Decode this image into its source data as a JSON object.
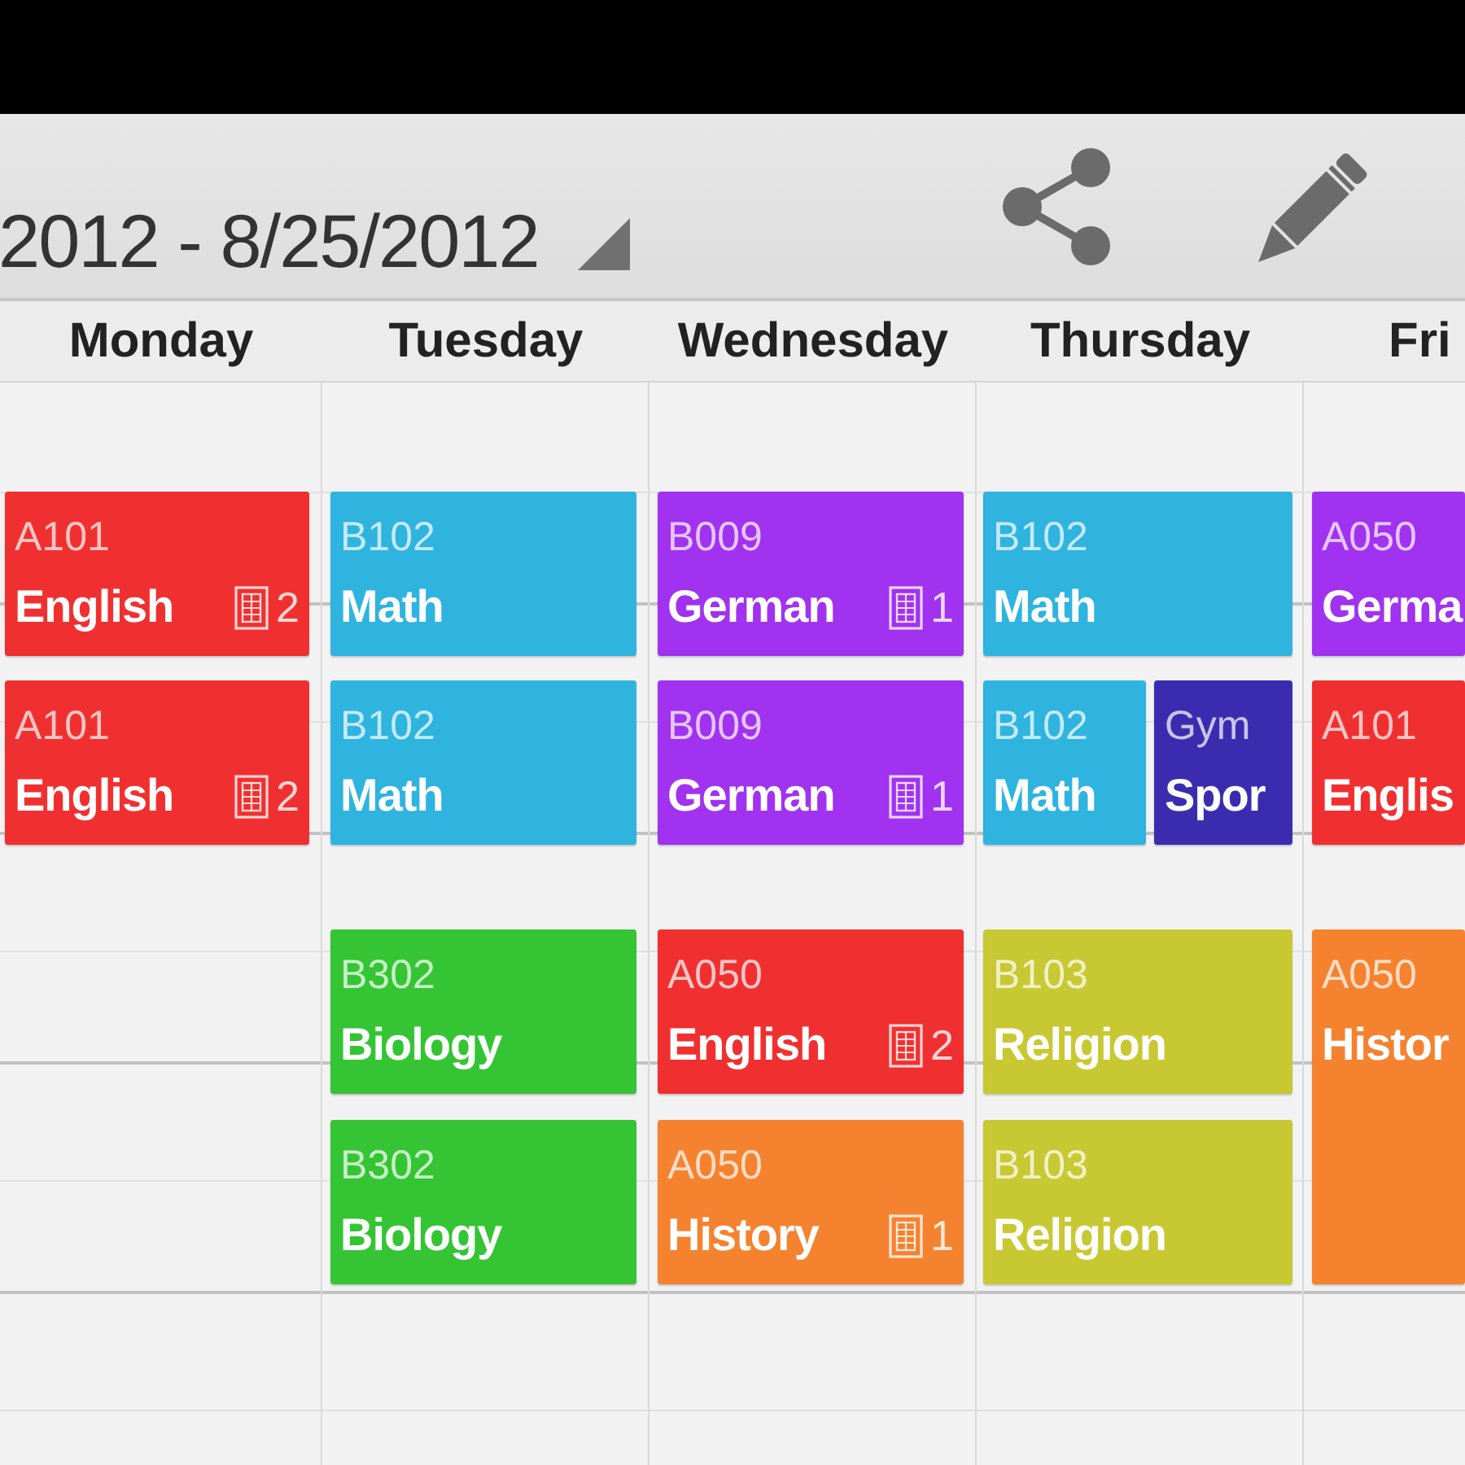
{
  "action_bar": {
    "date_range": "2012 - 8/25/2012"
  },
  "days": [
    {
      "name": "Monday",
      "periods": [
        {
          "kind": "single",
          "room": "A101",
          "subject": "English",
          "homework": "2",
          "color": "#f03030"
        },
        {
          "kind": "single",
          "room": "A101",
          "subject": "English",
          "homework": "2",
          "color": "#f03030"
        }
      ]
    },
    {
      "name": "Tuesday",
      "periods": [
        {
          "kind": "single",
          "room": "B102",
          "subject": "Math",
          "color": "#2eb4de"
        },
        {
          "kind": "single",
          "room": "B102",
          "subject": "Math",
          "color": "#2eb4de"
        },
        {
          "kind": "single",
          "room": "B302",
          "subject": "Biology",
          "color": "#34c434"
        },
        {
          "kind": "single",
          "room": "B302",
          "subject": "Biology",
          "color": "#34c434"
        }
      ]
    },
    {
      "name": "Wednesday",
      "periods": [
        {
          "kind": "single",
          "room": "B009",
          "subject": "German",
          "homework": "1",
          "color": "#a032f0"
        },
        {
          "kind": "single",
          "room": "B009",
          "subject": "German",
          "homework": "1",
          "color": "#a032f0"
        },
        {
          "kind": "single",
          "room": "A050",
          "subject": "English",
          "homework": "2",
          "color": "#f03030"
        },
        {
          "kind": "single",
          "room": "A050",
          "subject": "History",
          "homework": "1",
          "color": "#f5822f"
        }
      ]
    },
    {
      "name": "Thursday",
      "periods": [
        {
          "kind": "single",
          "room": "B102",
          "subject": "Math",
          "color": "#2eb4de"
        },
        {
          "kind": "split",
          "lessons": [
            {
              "room": "B102",
              "subject": "Math",
              "color": "#2eb4de"
            },
            {
              "room": "Gym",
              "subject": "Spor",
              "color": "#3b2caf"
            }
          ]
        },
        {
          "kind": "single",
          "room": "B103",
          "subject": "Religion",
          "color": "#c8c832"
        },
        {
          "kind": "single",
          "room": "B103",
          "subject": "Religion",
          "color": "#c8c832"
        }
      ]
    },
    {
      "name": "Fri",
      "periods": [
        {
          "kind": "single",
          "room": "A050",
          "subject": "Germa",
          "color": "#a032f0"
        },
        {
          "kind": "single",
          "room": "A101",
          "subject": "Englis",
          "color": "#f03030"
        },
        {
          "kind": "double",
          "room": "A050",
          "subject": "Histor",
          "color": "#f5822f"
        }
      ]
    }
  ]
}
